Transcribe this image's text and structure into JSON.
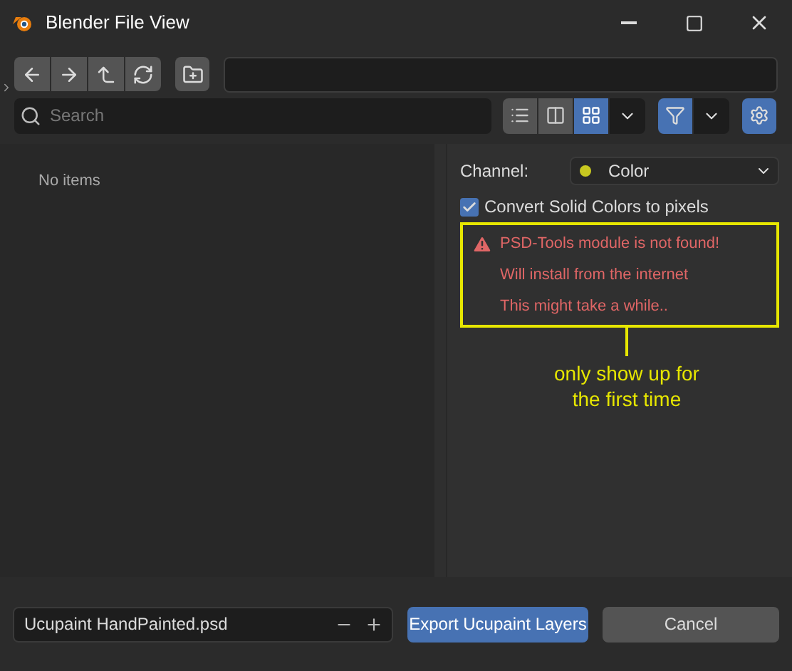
{
  "window": {
    "title": "Blender File View"
  },
  "nav_buttons": [
    {
      "kind": "back"
    },
    {
      "kind": "forward"
    },
    {
      "kind": "parent"
    },
    {
      "kind": "refresh"
    }
  ],
  "search": {
    "placeholder": "Search"
  },
  "view_modes": [
    {
      "kind": "vertical",
      "selected": false
    },
    {
      "kind": "horizontal",
      "selected": false
    },
    {
      "kind": "thumbnails",
      "selected": true
    }
  ],
  "filter": {
    "on": true
  },
  "settings": {
    "on": true
  },
  "file_list": {
    "empty_text": "No items"
  },
  "options": {
    "channel_label": "Channel:",
    "channel_value": "Color",
    "convert": {
      "label": "Convert Solid Colors to pixels",
      "checked": true
    },
    "warnings": [
      "PSD-Tools module is not found!",
      "Will install from the internet",
      "This might take a while.."
    ]
  },
  "annotation": {
    "text": "only show up for the first time"
  },
  "footer": {
    "filename": "Ucupaint HandPainted.psd",
    "confirm": "Export Ucupaint Layers",
    "cancel": "Cancel"
  }
}
